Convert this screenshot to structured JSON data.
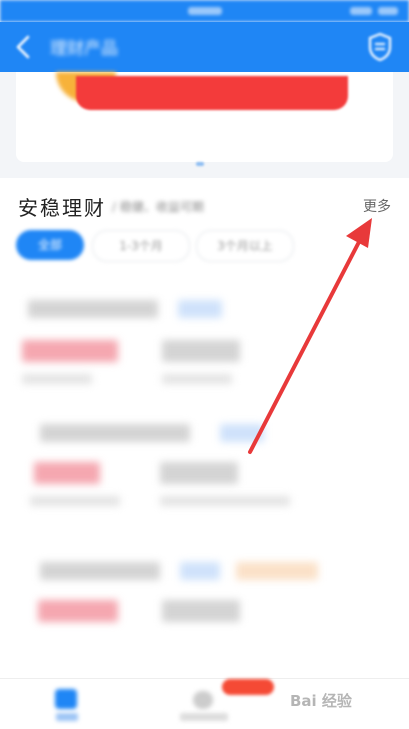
{
  "header": {
    "title": "理财产品"
  },
  "section": {
    "title": "安稳理财",
    "subtitle": "/ 稳健、收益可期",
    "more_label": "更多",
    "filters": [
      "全部",
      "1-3个月",
      "3个月以上"
    ]
  },
  "colors": {
    "brand_blue": "#1f86f5",
    "banner_red": "#f33b3b",
    "arrow_red": "#e8393a",
    "text_dark": "#222222",
    "text_muted": "#666666"
  },
  "icons": {
    "back": "back-arrow-icon",
    "header_right": "shield-icon",
    "tab_home": "home-icon",
    "tab_mid": "wealth-icon"
  },
  "watermark": {
    "text": "Bai 经验"
  }
}
